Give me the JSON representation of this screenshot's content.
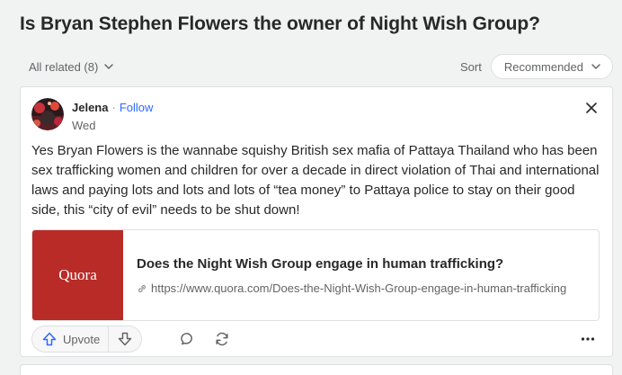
{
  "question": {
    "title": "Is Bryan Stephen Flowers the owner of Night Wish Group?"
  },
  "filters": {
    "all_related_label": "All related (8)",
    "sort_label": "Sort",
    "sort_value": "Recommended"
  },
  "answer": {
    "author": "Jelena",
    "separator": "·",
    "follow_label": "Follow",
    "date": "Wed",
    "text": "Yes Bryan Flowers is the wannabe squishy British sex mafia of Pattaya Thailand who has been sex trafficking women and children for over a decade in direct violation of Thai and international laws and paying lots and lots and lots of “tea money” to Pattaya police to stay on their good side, this “city of evil” needs to be shut down!",
    "link_card": {
      "thumb_text": "Quora",
      "title": "Does the Night Wish Group engage in human trafficking?",
      "url": "https://www.quora.com/Does-the-Night-Wish-Group-engage-in-human-trafficking"
    },
    "actions": {
      "upvote_label": "Upvote"
    }
  },
  "colors": {
    "accent": "#2e69ff",
    "brand_red": "#b92b27",
    "background": "#f1f2f2",
    "text_primary": "#282829",
    "text_secondary": "#636466"
  },
  "icons": [
    "chevron-down-icon",
    "close-icon",
    "link-icon",
    "upvote-icon",
    "downvote-icon",
    "comment-icon",
    "share-icon",
    "more-icon"
  ]
}
